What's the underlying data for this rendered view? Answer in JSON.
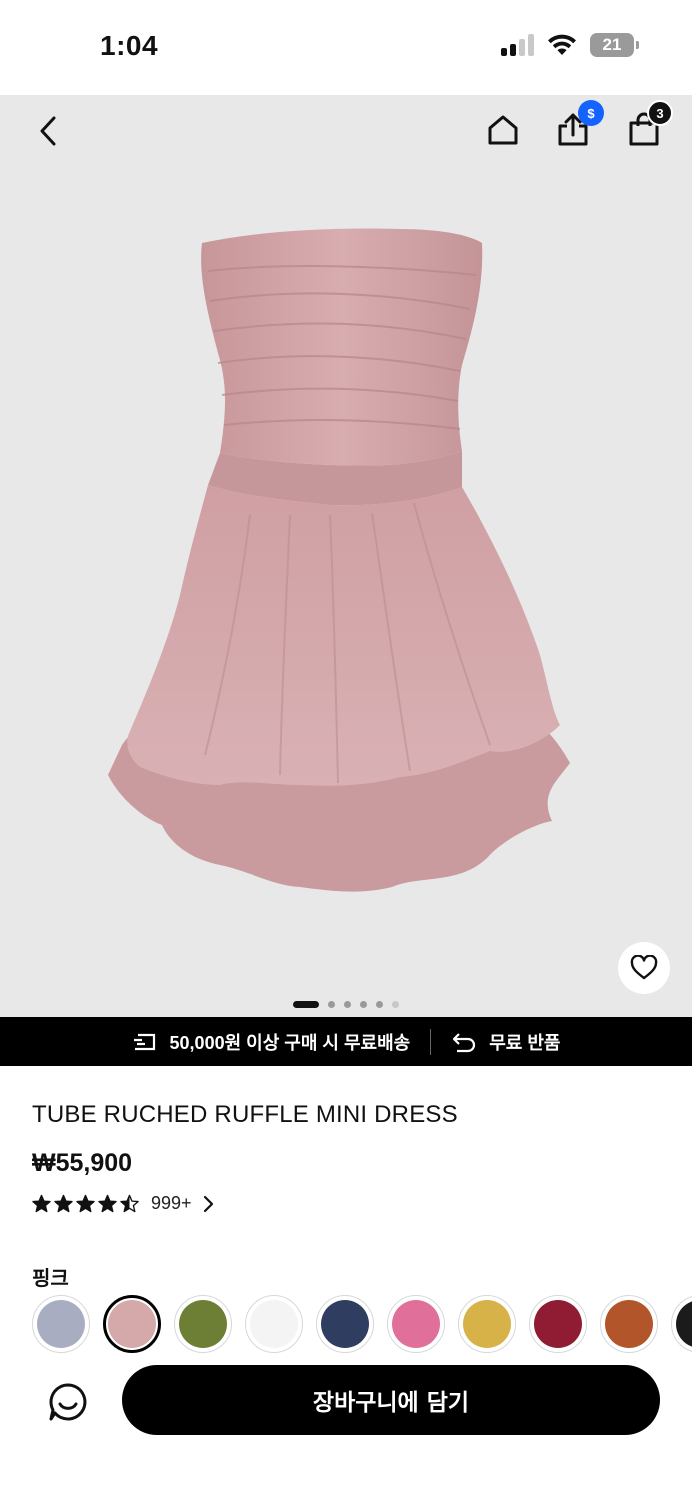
{
  "status": {
    "time": "1:04",
    "battery": "21"
  },
  "gallery": {
    "image_count": 6,
    "active_index": 0
  },
  "header": {
    "cart_count": "3",
    "share_badge": "$"
  },
  "shipping": {
    "free_shipping": "50,000원 이상 구매 시 무료배송",
    "free_returns": "무료 반품"
  },
  "product": {
    "title": "TUBE RUCHED RUFFLE MINI DRESS",
    "price": "₩55,900",
    "rating": 4.5,
    "review_count": "999+",
    "selected_color": "핑크"
  },
  "colors": {
    "swatches": [
      "#a9adc2",
      "#d5a9a9",
      "#6d7f34",
      "#f4f4f4",
      "#2f3e60",
      "#e0709a",
      "#d6b248",
      "#8f1c33",
      "#b2552a",
      "#1b1b1b"
    ],
    "selected_index": 1
  },
  "actions": {
    "add_to_cart": "장바구니에 담기"
  },
  "colors_theme": {
    "accent": "#000000",
    "badge_blue": "#1463ff",
    "hero_bg": "#e8e8e8",
    "dress": "#d2a5a8"
  }
}
